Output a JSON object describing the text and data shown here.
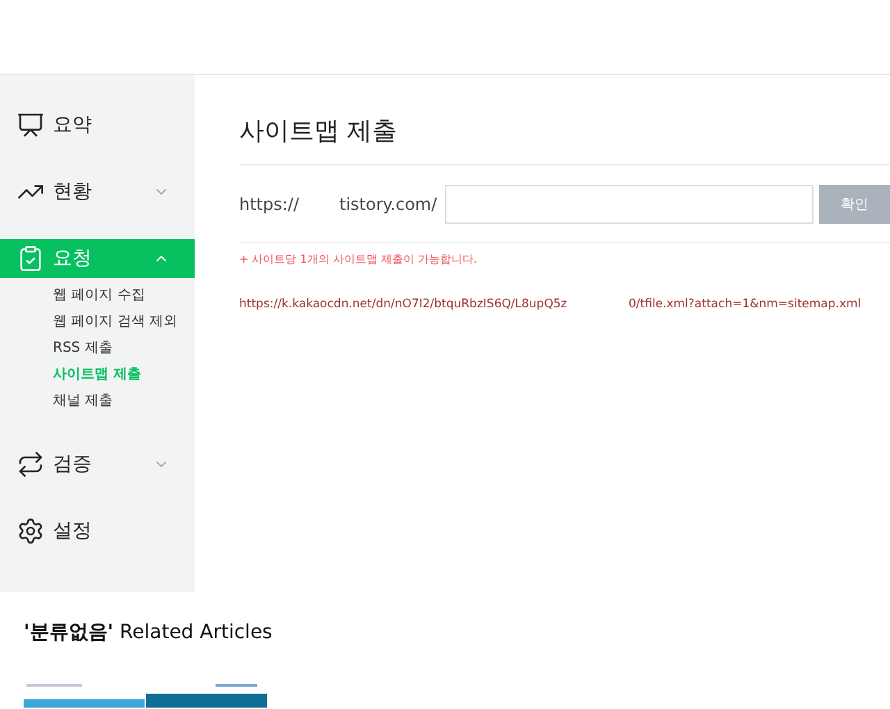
{
  "sidebar": {
    "items": [
      {
        "label": "요약",
        "kind": "link",
        "selected": false
      },
      {
        "label": "현황",
        "kind": "group",
        "selected": false,
        "expanded": false
      },
      {
        "label": "요청",
        "kind": "group",
        "selected": true,
        "expanded": true,
        "children": [
          {
            "label": "웹 페이지 수집",
            "selected": false
          },
          {
            "label": "웹 페이지 검색 제외",
            "selected": false
          },
          {
            "label": "RSS 제출",
            "selected": false
          },
          {
            "label": "사이트맵 제출",
            "selected": true
          },
          {
            "label": "채널 제출",
            "selected": false
          }
        ]
      },
      {
        "label": "검증",
        "kind": "group",
        "selected": false,
        "expanded": false
      },
      {
        "label": "설정",
        "kind": "link",
        "selected": false
      }
    ]
  },
  "main": {
    "title": "사이트맵 제출",
    "url_prefix": "https://",
    "url_suffix": "tistory.com/",
    "button": "확인",
    "note": "+ 사이트당 1개의 사이트맵 제출이 가능합니다.",
    "link_parts": [
      "https://k.kakaocdn.net/dn/nO7I2/btquRbzIS6Q/L8upQ5z",
      "0/tfile.xml?attach=1&nm=sitemap.xml"
    ]
  },
  "related": {
    "heading": "**'분류없음'** Related Articles"
  }
}
